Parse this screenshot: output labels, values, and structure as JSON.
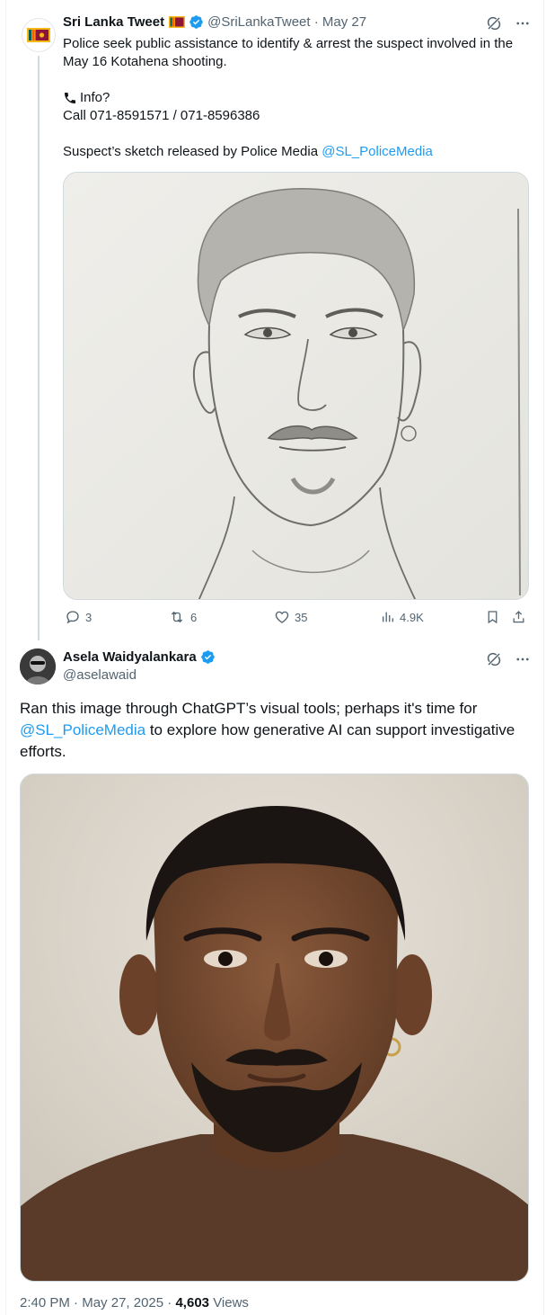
{
  "tweet1": {
    "display_name": "Sri Lanka Tweet",
    "handle": "@SriLankaTweet",
    "separator": " · ",
    "date": "May 27",
    "text_line1": "Police seek public assistance to identify & arrest the suspect involved in the May 16 Kotahena shooting.",
    "text_info": "Info?",
    "text_phone": "Call 071-8591571 / 071-8596386",
    "text_sketch_prefix": "Suspect’s sketch released by Police Media ",
    "mention": "@SL_PoliceMedia",
    "stats": {
      "replies": "3",
      "reposts": "6",
      "likes": "35",
      "views": "4.9K"
    }
  },
  "tweet2": {
    "display_name": "Asela Waidyalankara",
    "handle": "@aselawaid",
    "text_part1": "Ran this image through ChatGPT’s visual tools; perhaps it's time for ",
    "mention": "@SL_PoliceMedia",
    "text_part2": " to explore how generative AI can support investigative efforts.",
    "time": "2:40 PM",
    "date": "May 27, 2025",
    "views_count": "4,603",
    "views_label": "Views",
    "separator": " · "
  },
  "icons": {
    "flag": "sri-lanka-flag-icon",
    "verified": "verified-badge-icon",
    "grok": "grok-icon",
    "more": "more-icon",
    "reply": "reply-icon",
    "repost": "repost-icon",
    "like": "like-icon",
    "views": "views-icon",
    "bookmark": "bookmark-icon",
    "share": "share-icon"
  },
  "colors": {
    "link": "#1d9bf0",
    "verified": "#1d9bf0",
    "muted": "#536471",
    "text": "#0f1419"
  }
}
